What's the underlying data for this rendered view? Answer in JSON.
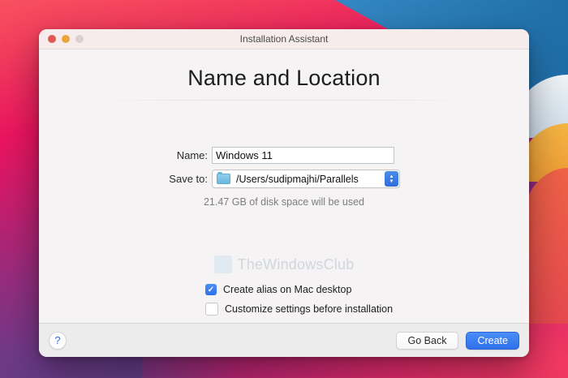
{
  "window": {
    "title": "Installation Assistant",
    "heading": "Name and Location"
  },
  "form": {
    "name": {
      "label": "Name:",
      "value": "Windows 11"
    },
    "save_to": {
      "label": "Save to:",
      "value": "/Users/sudipmajhi/Parallels"
    },
    "disk_note": "21.47 GB of disk space will be used"
  },
  "checkboxes": [
    {
      "label": "Create alias on Mac desktop",
      "checked": true,
      "mark": "✓"
    },
    {
      "label": "Customize settings before installation",
      "checked": false,
      "mark": ""
    }
  ],
  "watermark": "TheWindowsClub",
  "footer": {
    "help": "?",
    "go_back": "Go Back",
    "create": "Create"
  },
  "icons": {
    "stepper_up": "▲",
    "stepper_down": "▼"
  },
  "colors": {
    "accent_blue": "#3478f6",
    "wallpaper_red": "#f2415c",
    "wallpaper_blue": "#3a93d0",
    "wallpaper_orange": "#f0a23c",
    "wallpaper_magenta": "#e02a6b",
    "wallpaper_purple": "#5f3d85",
    "titlebar_bg": "#f6ecec",
    "window_bg": "#f5f3f3",
    "footer_bg": "#ececec"
  }
}
